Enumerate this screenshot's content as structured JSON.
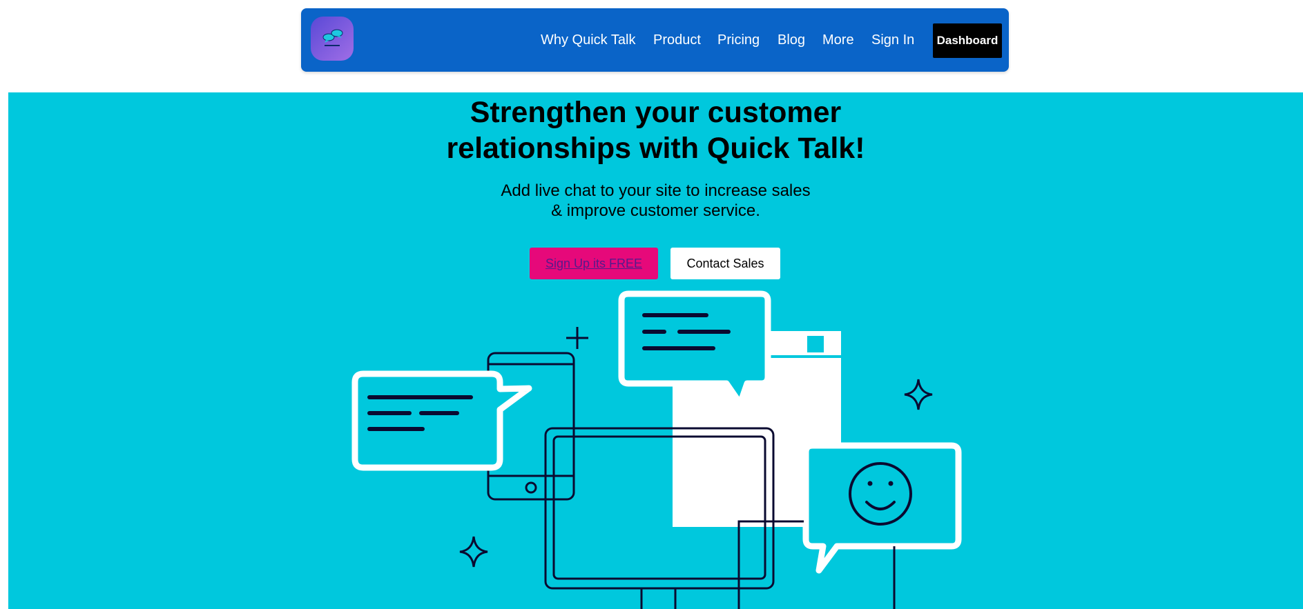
{
  "nav": {
    "logo_icon": "chat-bubbles-logo-icon",
    "links": [
      "Why Quick Talk",
      "Product",
      "Pricing",
      "Blog",
      "More",
      "Sign In"
    ],
    "dashboard_label": "Dashboard"
  },
  "hero": {
    "title_line1": "Strengthen your customer",
    "title_line2": "relationships with Quick Talk!",
    "subtitle_line1": "Add live chat to your site to increase sales",
    "subtitle_line2": "& improve customer service.",
    "signup_label": "Sign Up its FREE",
    "contact_label": "Contact Sales"
  },
  "colors": {
    "nav_bg": "#0a64c8",
    "hero_bg": "#00c8dd",
    "signup_bg": "#e6097a",
    "dashboard_bg": "#000000",
    "line_art": "#0a0a30"
  },
  "illustration": {
    "icons": [
      "chat-bubble-icon",
      "smartphone-icon",
      "monitor-icon",
      "browser-window-icon",
      "smiley-chat-icon",
      "sparkle-icon",
      "plus-icon"
    ]
  }
}
